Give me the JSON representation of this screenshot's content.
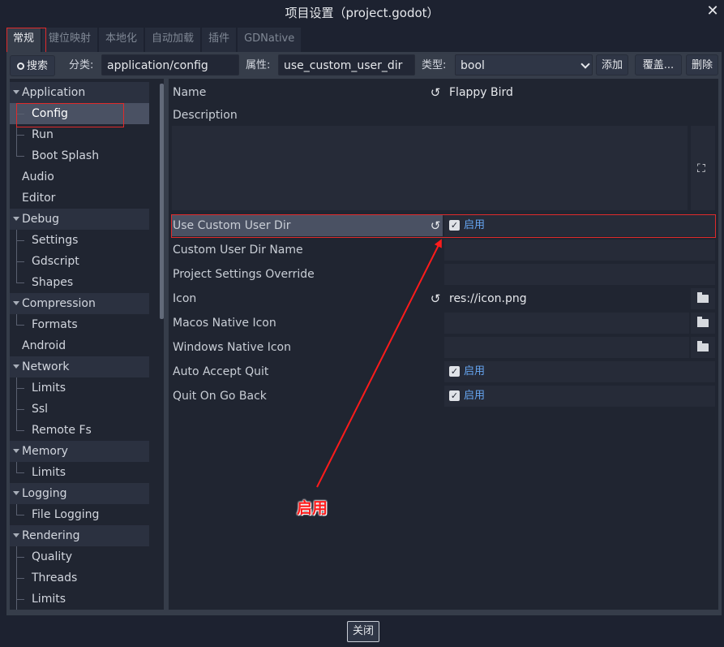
{
  "window": {
    "title": "项目设置（project.godot）",
    "close_icon": "close-icon"
  },
  "tabs": [
    {
      "label": "常规",
      "active": true
    },
    {
      "label": "键位映射"
    },
    {
      "label": "本地化"
    },
    {
      "label": "自动加载"
    },
    {
      "label": "插件"
    },
    {
      "label": "GDNative"
    }
  ],
  "toolbar": {
    "search_label": "搜索",
    "category_label": "分类:",
    "category_value": "application/config",
    "property_label": "属性:",
    "property_value": "use_custom_user_dir",
    "type_label": "类型:",
    "type_value": "bool",
    "add_label": "添加",
    "override_label": "覆盖...",
    "delete_label": "删除"
  },
  "tree": [
    {
      "label": "Application",
      "category": true
    },
    {
      "label": "Config",
      "selected": true
    },
    {
      "label": "Run"
    },
    {
      "label": "Boot Splash"
    },
    {
      "label": "Audio",
      "top": true
    },
    {
      "label": "Editor",
      "top": true
    },
    {
      "label": "Debug",
      "category": true
    },
    {
      "label": "Settings"
    },
    {
      "label": "Gdscript"
    },
    {
      "label": "Shapes"
    },
    {
      "label": "Compression",
      "category": true
    },
    {
      "label": "Formats"
    },
    {
      "label": "Android",
      "top": true
    },
    {
      "label": "Network",
      "category": true
    },
    {
      "label": "Limits"
    },
    {
      "label": "Ssl"
    },
    {
      "label": "Remote Fs"
    },
    {
      "label": "Memory",
      "category": true
    },
    {
      "label": "Limits"
    },
    {
      "label": "Logging",
      "category": true
    },
    {
      "label": "File Logging"
    },
    {
      "label": "Rendering",
      "category": true
    },
    {
      "label": "Quality"
    },
    {
      "label": "Threads"
    },
    {
      "label": "Limits"
    }
  ],
  "properties": {
    "name": {
      "label": "Name",
      "value": "Flappy Bird"
    },
    "description": {
      "label": "Description"
    },
    "use_custom_user_dir": {
      "label": "Use Custom User Dir",
      "value": "启用",
      "checked": true
    },
    "custom_user_dir_name": {
      "label": "Custom User Dir Name",
      "value": ""
    },
    "project_settings_override": {
      "label": "Project Settings Override",
      "value": ""
    },
    "icon": {
      "label": "Icon",
      "value": "res://icon.png"
    },
    "macos_native_icon": {
      "label": "Macos Native Icon",
      "value": ""
    },
    "windows_native_icon": {
      "label": "Windows Native Icon",
      "value": ""
    },
    "auto_accept_quit": {
      "label": "Auto Accept Quit",
      "value": "启用",
      "checked": true
    },
    "quit_on_go_back": {
      "label": "Quit On Go Back",
      "value": "启用",
      "checked": true
    }
  },
  "footer": {
    "close_label": "关闭"
  },
  "annotation": {
    "text": "启用",
    "color": "#ff1b1b"
  }
}
